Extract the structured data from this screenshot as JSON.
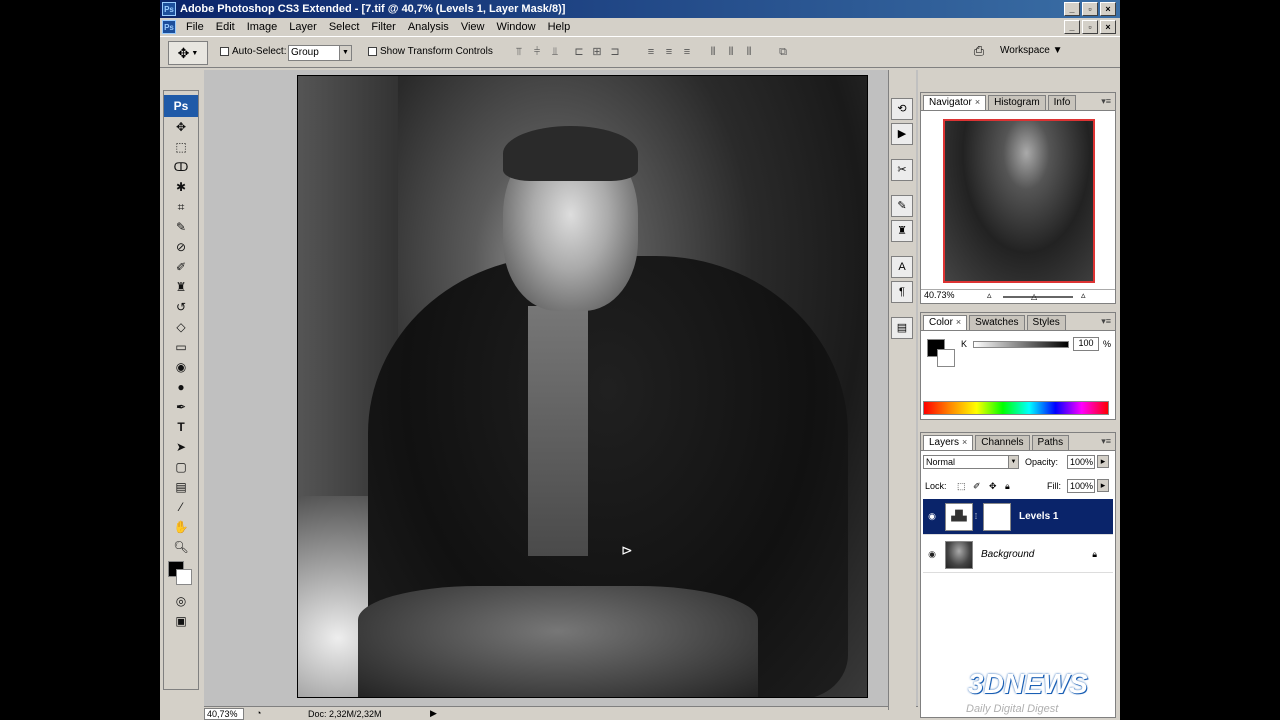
{
  "window": {
    "title": "Adobe Photoshop CS3 Extended - [7.tif @ 40,7% (Levels 1, Layer Mask/8)]",
    "app_icon": "Ps"
  },
  "menubar": {
    "items": [
      "File",
      "Edit",
      "Image",
      "Layer",
      "Select",
      "Filter",
      "Analysis",
      "View",
      "Window",
      "Help"
    ]
  },
  "options": {
    "auto_select_label": "Auto-Select:",
    "auto_select_value": "Group",
    "show_transform_label": "Show Transform Controls",
    "workspace_label": "Workspace ▼"
  },
  "toolbox": {
    "logo": "Ps",
    "tools": [
      "move-icon",
      "marquee-icon",
      "lasso-icon",
      "magic-wand-icon",
      "crop-icon",
      "slice-icon",
      "healing-icon",
      "brush-icon",
      "clone-stamp-icon",
      "history-brush-icon",
      "eraser-icon",
      "gradient-icon",
      "blur-icon",
      "dodge-icon",
      "pen-icon",
      "type-icon",
      "path-select-icon",
      "shape-icon",
      "notes-icon",
      "eyedropper-icon",
      "hand-icon",
      "zoom-icon"
    ]
  },
  "status": {
    "zoom": "40,73%",
    "doc": "Doc: 2,32M/2,32M"
  },
  "navigator": {
    "tabs": [
      "Navigator",
      "Histogram",
      "Info"
    ],
    "zoom": "40.73%"
  },
  "color": {
    "tabs": [
      "Color",
      "Swatches",
      "Styles"
    ],
    "channel_label": "K",
    "value": "100",
    "unit": "%"
  },
  "layers": {
    "tabs": [
      "Layers",
      "Channels",
      "Paths"
    ],
    "blend_mode": "Normal",
    "opacity_label": "Opacity:",
    "opacity_value": "100%",
    "lock_label": "Lock:",
    "fill_label": "Fill:",
    "fill_value": "100%",
    "items": [
      {
        "name": "Levels 1",
        "selected": true
      },
      {
        "name": "Background",
        "selected": false
      }
    ]
  },
  "watermark": {
    "brand": "3DNEWS",
    "tagline": "Daily Digital Digest"
  }
}
